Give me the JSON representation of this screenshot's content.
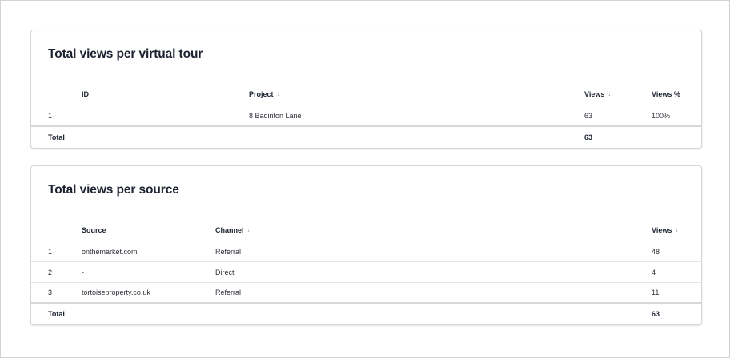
{
  "tours_card": {
    "title": "Total views per virtual tour",
    "headers": {
      "id": "ID",
      "project": "Project",
      "views": "Views",
      "views_pct": "Views %"
    },
    "rows": [
      {
        "index": "1",
        "id": "",
        "project": "8 Badinton Lane",
        "views": "63",
        "views_pct": "100%"
      }
    ],
    "total": {
      "label": "Total",
      "views": "63"
    }
  },
  "sources_card": {
    "title": "Total views per source",
    "headers": {
      "source": "Source",
      "channel": "Channel",
      "views": "Views"
    },
    "rows": [
      {
        "index": "1",
        "source": "onthemarket.com",
        "channel": "Referral",
        "views": "48"
      },
      {
        "index": "2",
        "source": "-",
        "channel": "Direct",
        "views": "4"
      },
      {
        "index": "3",
        "source": "tortoiseproperty.co.uk",
        "channel": "Referral",
        "views": "11"
      }
    ],
    "total": {
      "label": "Total",
      "views": "63"
    }
  },
  "icons": {
    "sort": "sort-down-arrow-icon"
  },
  "colors": {
    "border": "#d3d6da",
    "text": "#1c2230",
    "muted": "#9aa0a8"
  }
}
